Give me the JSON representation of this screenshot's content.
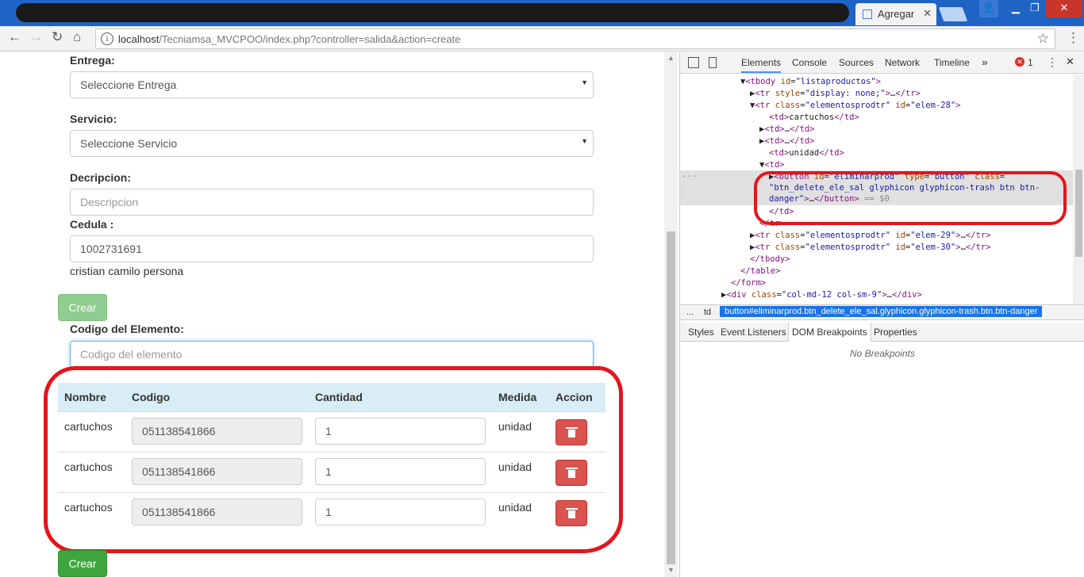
{
  "browser": {
    "active_tab": "Agregar",
    "url_host": "localhost",
    "url_path": "/Tecniamsa_MVCPOO/index.php?controller=salida&action=create"
  },
  "form": {
    "entrega_label": "Entrega:",
    "entrega_value": "Seleccione Entrega",
    "servicio_label": "Servicio:",
    "servicio_value": "Seleccione Servicio",
    "descripcion_label": "Decripcion:",
    "descripcion_placeholder": "Descripcion",
    "cedula_label": "Cedula :",
    "cedula_value": "1002731691",
    "persona_name": "cristian camilo persona",
    "crear_label": "Crear",
    "codigo_label": "Codigo del Elemento:",
    "codigo_placeholder": "Codigo del elemento"
  },
  "table": {
    "headers": {
      "nombre": "Nombre",
      "codigo": "Codigo",
      "cantidad": "Cantidad",
      "medida": "Medida",
      "accion": "Accion"
    },
    "rows": [
      {
        "nombre": "cartuchos",
        "codigo": "051138541866",
        "cantidad": "1",
        "medida": "unidad"
      },
      {
        "nombre": "cartuchos",
        "codigo": "051138541866",
        "cantidad": "1",
        "medida": "unidad"
      },
      {
        "nombre": "cartuchos",
        "codigo": "051138541866",
        "cantidad": "1",
        "medida": "unidad"
      }
    ]
  },
  "footer": {
    "crear_label": "Crear"
  },
  "devtools": {
    "tabs": [
      "Elements",
      "Console",
      "Sources",
      "Network",
      "Timeline"
    ],
    "more": "»",
    "error_count": "1",
    "breadcrumb_prefix": "...",
    "breadcrumb_td": "td",
    "breadcrumb_current": "button#eliminarprod.btn_delete_ele_sal.glyphicon.glyphicon-trash.btn.btn-danger",
    "subtabs": [
      "Styles",
      "Event Listeners",
      "DOM Breakpoints",
      "Properties"
    ],
    "no_breakpoints": "No Breakpoints"
  }
}
